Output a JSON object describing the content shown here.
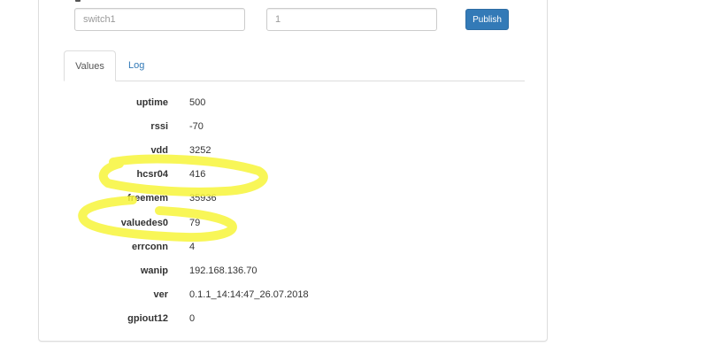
{
  "form": {
    "topic_placeholder": "switch1",
    "value_placeholder": "1",
    "publish_label": "Publish"
  },
  "tabs": [
    {
      "label": "Values",
      "active": true
    },
    {
      "label": "Log",
      "active": false
    }
  ],
  "values": [
    {
      "key": "uptime",
      "value": "500"
    },
    {
      "key": "rssi",
      "value": "-70"
    },
    {
      "key": "vdd",
      "value": "3252"
    },
    {
      "key": "hcsr04",
      "value": "416"
    },
    {
      "key": "freemem",
      "value": "35936"
    },
    {
      "key": "valuedes0",
      "value": "79"
    },
    {
      "key": "errconn",
      "value": "4"
    },
    {
      "key": "wanip",
      "value": "192.168.136.70"
    },
    {
      "key": "ver",
      "value": "0.1.1_14:14:47_26.07.2018"
    },
    {
      "key": "gpiout12",
      "value": "0"
    }
  ],
  "colors": {
    "primary": "#337ab7",
    "highlight_marker": "#f7f53a"
  }
}
